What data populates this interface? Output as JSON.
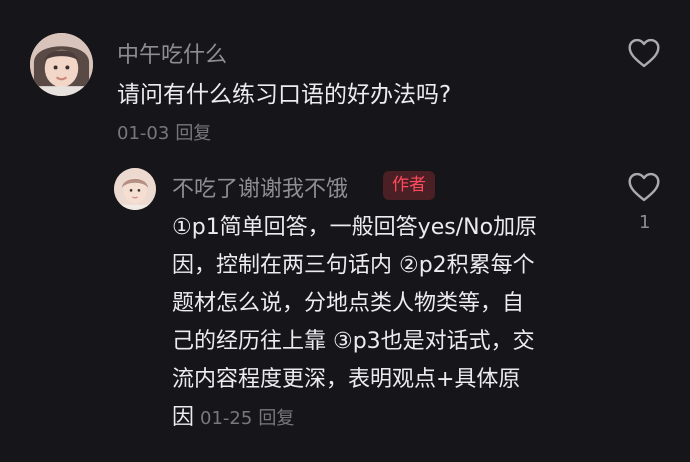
{
  "comment1": {
    "username": "中午吃什么",
    "text": "请问有什么练习口语的好办法吗?",
    "date": "01-03",
    "reply_label": "回复"
  },
  "comment2": {
    "username": "不吃了谢谢我不饿",
    "badge": "作者",
    "text": "①p1简单回答，一般回答yes/No加原\n因，控制在两三句话内 ②p2积累每个\n题材怎么说，分地点类人物类等，自\n己的经历往上靠 ③p3也是对话式，交\n流内容程度更深，表明观点+具体原\n因",
    "date": "01-25",
    "reply_label": "回复",
    "like_count": "1"
  },
  "colors": {
    "background": "#16161a",
    "username": "#8d8d93",
    "text": "#ececee",
    "meta": "#77777d",
    "badge_bg": "#4a2024",
    "badge_text": "#ff4a5d"
  },
  "icons": {
    "like": "heart-outline-icon"
  }
}
